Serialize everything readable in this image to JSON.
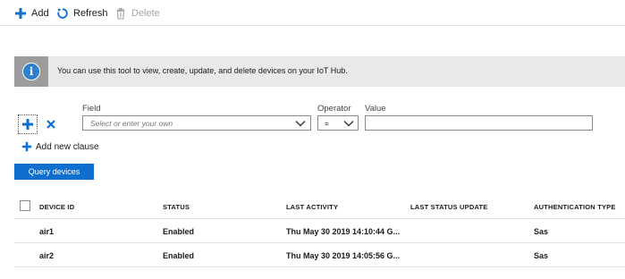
{
  "toolbar": {
    "add_label": "Add",
    "refresh_label": "Refresh",
    "delete_label": "Delete"
  },
  "banner": {
    "icon_glyph": "i",
    "text": "You can use this tool to view, create, update, and delete devices on your IoT Hub."
  },
  "filter": {
    "field_label": "Field",
    "field_placeholder": "Select or enter your own",
    "operator_label": "Operator",
    "operator_value": "=",
    "value_label": "Value",
    "value_value": "",
    "add_clause_label": "Add new clause",
    "query_button_label": "Query devices"
  },
  "table": {
    "headers": {
      "device_id": "DEVICE ID",
      "status": "STATUS",
      "last_activity": "LAST ACTIVITY",
      "last_status_update": "LAST STATUS UPDATE",
      "authentication_type": "AUTHENTICATION TYPE"
    },
    "rows": [
      {
        "device_id": "air1",
        "status": "Enabled",
        "last_activity": "Thu May 30 2019 14:10:44 G...",
        "last_status_update": "",
        "authentication_type": "Sas"
      },
      {
        "device_id": "air2",
        "status": "Enabled",
        "last_activity": "Thu May 30 2019 14:05:56 G...",
        "last_status_update": "",
        "authentication_type": "Sas"
      }
    ]
  },
  "colors": {
    "accent": "#0f6fcf",
    "banner_bg": "#e9e9e9",
    "banner_icon_bg": "#9c9c9c"
  }
}
